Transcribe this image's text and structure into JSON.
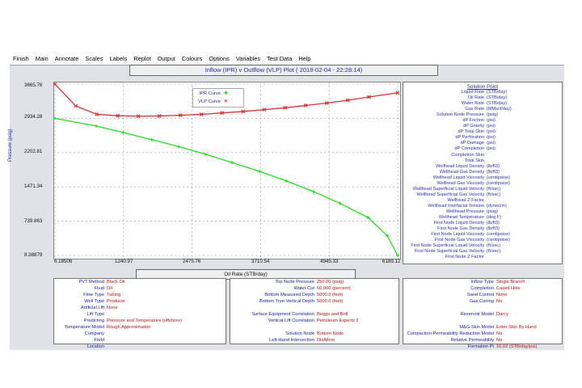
{
  "menu": [
    "Finish",
    "Main",
    "Annotate",
    "Scales",
    "Labels",
    "Replot",
    "Output",
    "Colours",
    "Options",
    "Variables",
    "Test Data",
    "Help"
  ],
  "plot_title": "Inflow (IPR) v Outflow (VLP) Plot ( 2018-02-04 - 22:28:14)",
  "legend": {
    "ipr": "IPR Curve",
    "vlp": "VLP Curve"
  },
  "colors": {
    "ipr": "#22dd22",
    "vlp": "#e03030",
    "accent": "#2a2aa8"
  },
  "y_axis_label": "Pressure (psig)",
  "x_axis_label": "Oil Rate (STB/day)",
  "chart_data": {
    "type": "line",
    "xlabel": "Oil Rate (STB/day)",
    "ylabel": "Pressure (psig)",
    "xlim": [
      6.18506,
      6189.12
    ],
    "ylim": [
      8.38879,
      3665.76
    ],
    "x_ticks": [
      "6.18506",
      "1240.97",
      "2475.76",
      "3710.54",
      "4945.33",
      "6189.12"
    ],
    "y_ticks": [
      "3665.76",
      "2934.28",
      "2202.81",
      "1471.34",
      "739.863",
      "8.38879"
    ],
    "grid": true,
    "legend_position": "top-center",
    "series": [
      {
        "name": "IPR Curve",
        "x": [
          6.2,
          750,
          1240,
          1750,
          2240,
          2720,
          3200,
          3700,
          4180,
          4670,
          5150,
          5650,
          6000,
          6189
        ],
        "y": [
          2934,
          2770,
          2630,
          2480,
          2330,
          2170,
          1990,
          1800,
          1600,
          1370,
          1120,
          820,
          430,
          8
        ]
      },
      {
        "name": "VLP Curve",
        "x": [
          6.2,
          380,
          760,
          1140,
          1510,
          1890,
          2270,
          2650,
          3020,
          3400,
          3780,
          4160,
          4530,
          4910,
          5290,
          5670,
          6189
        ],
        "y": [
          3665,
          3200,
          3020,
          2990,
          2980,
          2985,
          3000,
          3020,
          3050,
          3080,
          3120,
          3160,
          3210,
          3260,
          3320,
          3390,
          3480
        ]
      }
    ]
  },
  "solution_point": {
    "title": "Solution Point",
    "rows": [
      {
        "label": "Liquid Rate",
        "unit": "(STB/day)"
      },
      {
        "label": "Oil Rate",
        "unit": "(STB/day)"
      },
      {
        "label": "Water Rate",
        "unit": "(STB/day)"
      },
      {
        "label": "Gas Rate",
        "unit": "(MMscf/day)"
      },
      {
        "label": "Solution Node Pressure",
        "unit": "(psig)"
      },
      {
        "label": "dP Friction",
        "unit": "(psi)"
      },
      {
        "label": "dP Gravity",
        "unit": "(psi)"
      },
      {
        "label": "dP Total Skin",
        "unit": "(psi)"
      },
      {
        "label": "dP Perforation",
        "unit": "(psi)"
      },
      {
        "label": "dP Damage",
        "unit": "(psi)"
      },
      {
        "label": "dP Completion",
        "unit": "(psi)"
      },
      {
        "label": "Completion Skin",
        "unit": ""
      },
      {
        "label": "Total Skin",
        "unit": ""
      },
      {
        "label": "Wellhead Liquid Density",
        "unit": "(lb/ft3)"
      },
      {
        "label": "Wellhead Gas Density",
        "unit": "(lb/ft3)"
      },
      {
        "label": "Wellhead Liquid Viscosity",
        "unit": "(centipoise)"
      },
      {
        "label": "Wellhead Gas Viscosity",
        "unit": "(centipoise)"
      },
      {
        "label": "Wellhead Superficial Liquid Velocity",
        "unit": "(ft/sec)"
      },
      {
        "label": "Wellhead Superficial Gas Velocity",
        "unit": "(ft/sec)"
      },
      {
        "label": "Wellhead Z Factor",
        "unit": ""
      },
      {
        "label": "Wellhead Interfacial Tension",
        "unit": "(dyne/cm)"
      },
      {
        "label": "Wellhead Pressure",
        "unit": "(psig)"
      },
      {
        "label": "Wellhead Temperature",
        "unit": "(deg F)"
      },
      {
        "label": "First Node Liquid Density",
        "unit": "(lb/ft3)"
      },
      {
        "label": "First Node Gas Density",
        "unit": "(lb/ft3)"
      },
      {
        "label": "First Node Liquid Viscosity",
        "unit": "(centipoise)"
      },
      {
        "label": "First Node Gas Viscosity",
        "unit": "(centipoise)"
      },
      {
        "label": "First Node Superficial Liquid Velocity",
        "unit": "(ft/sec)"
      },
      {
        "label": "First Node Superficial Gas Velocity",
        "unit": "(ft/sec)"
      },
      {
        "label": "First Node Z Factor",
        "unit": ""
      }
    ]
  },
  "panel_left": [
    {
      "k": "PVT Method",
      "v": "Black Oil"
    },
    {
      "k": "Fluid",
      "v": "Oil"
    },
    {
      "k": "Flow Type",
      "v": "Tubing"
    },
    {
      "k": "Well Type",
      "v": "Producer"
    },
    {
      "k": "Artificial Lift",
      "v": "None"
    },
    {
      "k": "Lift Type",
      "v": ""
    },
    {
      "k": "Predicting",
      "v": "Pressure and Temperature (offshore)"
    },
    {
      "k": "Temperature Model",
      "v": "Rough Approximation"
    },
    {
      "k": "Company",
      "v": ""
    },
    {
      "k": "Field",
      "v": ""
    },
    {
      "k": "Location",
      "v": ""
    }
  ],
  "panel_mid": [
    {
      "k": "Top Node Pressure",
      "v": "250.00  (psig)"
    },
    {
      "k": "Water Cut",
      "v": "60.000  (percent)"
    },
    {
      "k": "Bottom Measured Depth",
      "v": "5000.0  (feet)"
    },
    {
      "k": "Bottom True Vertical Depth",
      "v": "5000.0  (feet)"
    },
    {
      "k": "",
      "v": ""
    },
    {
      "k": "Surface Equipment Correlation",
      "v": "Beggs and Brill"
    },
    {
      "k": "Vertical Lift Correlation",
      "v": "Petroleum Experts 2"
    },
    {
      "k": "",
      "v": ""
    },
    {
      "k": "Solution Node",
      "v": "Bottom Node"
    },
    {
      "k": "Left-Hand Intersection",
      "v": "DisAllow"
    }
  ],
  "panel_right": [
    {
      "k": "Inflow Type",
      "v": "Single Branch"
    },
    {
      "k": "Completion",
      "v": "Cased Hole"
    },
    {
      "k": "Sand Control",
      "v": "None"
    },
    {
      "k": "Gas Coning",
      "v": "No"
    },
    {
      "k": "",
      "v": ""
    },
    {
      "k": "Reservoir Model",
      "v": "Darcy"
    },
    {
      "k": "",
      "v": ""
    },
    {
      "k": "M&G Skin Model",
      "v": "Enter Skin By Hand"
    },
    {
      "k": "Compaction Permeability Reduction Model",
      "v": "No"
    },
    {
      "k": "Relative Permeability",
      "v": "No"
    },
    {
      "k": "Formation PI",
      "v": "10.02  (STB/day/psi)"
    }
  ]
}
